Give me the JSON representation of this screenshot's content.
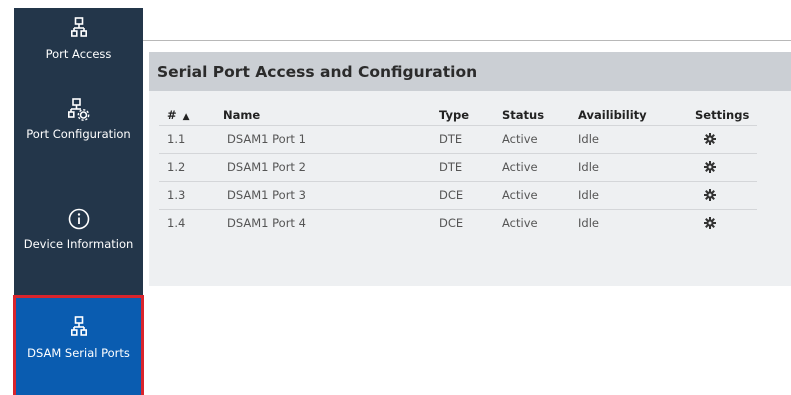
{
  "sidebar": {
    "items": [
      {
        "label": "Port Access",
        "icon": "network-icon"
      },
      {
        "label": "Port Configuration",
        "icon": "network-settings-icon"
      },
      {
        "label": "Device Information",
        "icon": "info-icon"
      },
      {
        "label": "DSAM Serial Ports",
        "icon": "network-icon",
        "active": true
      }
    ]
  },
  "panel": {
    "title": "Serial Port Access and Configuration"
  },
  "table": {
    "headers": {
      "num": "#",
      "sort_indicator": "▲",
      "name": "Name",
      "type": "Type",
      "status": "Status",
      "availability": "Availibility",
      "settings": "Settings"
    },
    "rows": [
      {
        "num": "1.1",
        "name": "DSAM1 Port 1",
        "type": "DTE",
        "status": "Active",
        "availability": "Idle"
      },
      {
        "num": "1.2",
        "name": "DSAM1 Port 2",
        "type": "DTE",
        "status": "Active",
        "availability": "Idle"
      },
      {
        "num": "1.3",
        "name": "DSAM1 Port 3",
        "type": "DCE",
        "status": "Active",
        "availability": "Idle"
      },
      {
        "num": "1.4",
        "name": "DSAM1 Port 4",
        "type": "DCE",
        "status": "Active",
        "availability": "Idle"
      }
    ]
  },
  "colors": {
    "sidebar_bg": "#23364a",
    "active_bg": "#0a5cb0",
    "active_border": "#d9242c",
    "panel_header_bg": "#cbcfd4",
    "panel_bg": "#eef0f2"
  }
}
